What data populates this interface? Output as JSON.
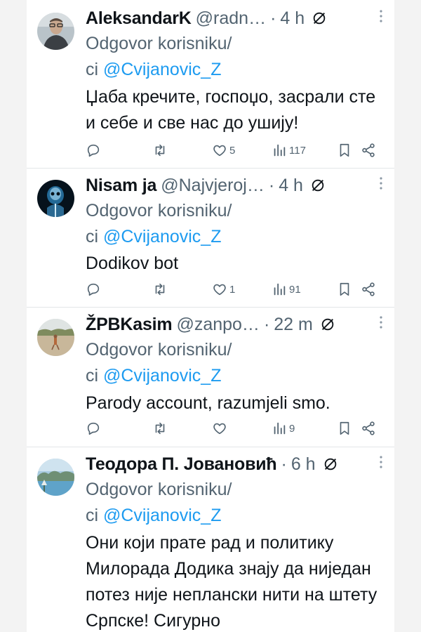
{
  "tweets": [
    {
      "name": "AleksandarK",
      "handle": "@radn…",
      "time": "4 h",
      "reply_label": "Odgovor korisniku/",
      "reply_prefix": "ci ",
      "reply_mention": "@Cvijanovic_Z",
      "text": "Џаба кречите, госпоџо, засрали сте и себе и све нас до ушију!",
      "likes": "5",
      "views": "117",
      "avatar": "man-with-glasses-photo"
    },
    {
      "name": "Nisam ja",
      "handle": "@Najvjeroj…",
      "time": "4 h",
      "reply_label": "Odgovor korisniku/",
      "reply_prefix": "ci ",
      "reply_mention": "@Cvijanovic_Z",
      "text": "Dodikov bot",
      "likes": "1",
      "views": "91",
      "avatar": "x-ray-skull-image"
    },
    {
      "name": "ŽPBKasim",
      "handle": "@zanpo…",
      "time": "22 m",
      "reply_label": "Odgovor korisniku/",
      "reply_prefix": "ci ",
      "reply_mention": "@Cvijanovic_Z",
      "text": "Parody account, razumjeli smo.",
      "likes": "",
      "views": "9",
      "avatar": "beach-photo"
    },
    {
      "name": "Теодора П. Јовановић",
      "handle": "",
      "time": "6 h",
      "reply_label": "Odgovor korisniku/",
      "reply_prefix": "ci ",
      "reply_mention": "@Cvijanovic_Z",
      "text": "Они који прате рад и политику Милорада Додика знају да ниједан потез није неплански нити на штету Српске! Сигурно",
      "likes": "",
      "views": "",
      "avatar": "lake-landscape-photo"
    }
  ],
  "separator": "·",
  "colors": {
    "accent": "#1d9bf0",
    "secondary": "#536471",
    "text": "#0f1419"
  },
  "icons": [
    "reply-icon",
    "retweet-icon",
    "like-icon",
    "views-icon",
    "bookmark-icon",
    "share-icon",
    "grok-icon",
    "more-icon"
  ]
}
